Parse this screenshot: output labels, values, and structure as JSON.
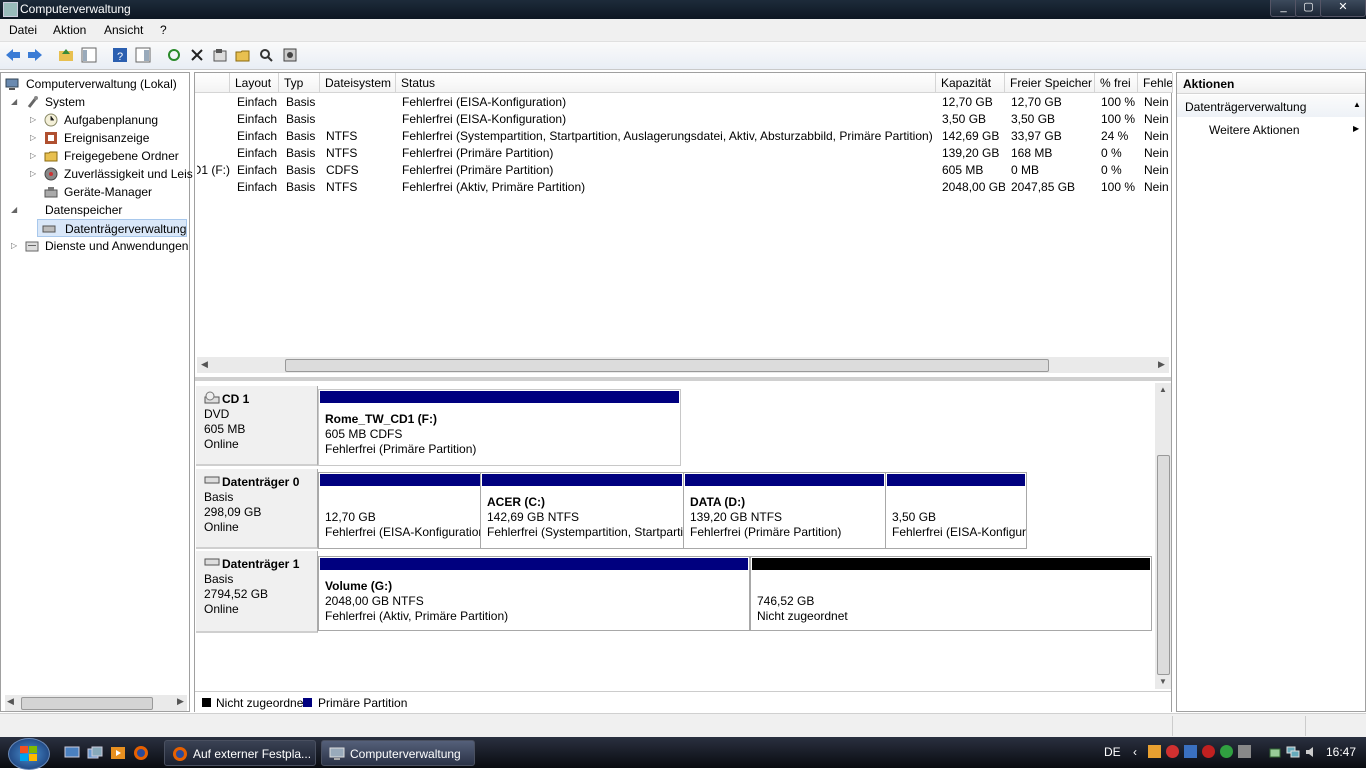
{
  "window": {
    "title": "Computerverwaltung"
  },
  "menu": [
    "Datei",
    "Aktion",
    "Ansicht",
    "?"
  ],
  "tree": {
    "root": "Computerverwaltung (Lokal)",
    "system": "System",
    "aufgaben": "Aufgabenplanung",
    "ereignis": "Ereignisanzeige",
    "ordner": "Freigegebene Ordner",
    "zuverl": "Zuverlässigkeit und Leis",
    "geraete": "Geräte-Manager",
    "datenspeicher": "Datenspeicher",
    "datentraeger": "Datenträgerverwaltung",
    "dienste": "Dienste und Anwendungen"
  },
  "list": {
    "headers": [
      "Layout",
      "Typ",
      "Dateisystem",
      "Status",
      "Kapazität",
      "Freier Speicher",
      "% frei",
      "Fehle"
    ],
    "rows": [
      {
        "volume": "",
        "layout": "Einfach",
        "typ": "Basis",
        "fs": "",
        "status": "Fehlerfrei (EISA-Konfiguration)",
        "kap": "12,70 GB",
        "frei": "12,70 GB",
        "pct": "100 %",
        "fehler": "Nein"
      },
      {
        "volume": "",
        "layout": "Einfach",
        "typ": "Basis",
        "fs": "",
        "status": "Fehlerfrei (EISA-Konfiguration)",
        "kap": "3,50 GB",
        "frei": "3,50 GB",
        "pct": "100 %",
        "fehler": "Nein"
      },
      {
        "volume": "",
        "layout": "Einfach",
        "typ": "Basis",
        "fs": "NTFS",
        "status": "Fehlerfrei (Systempartition, Startpartition, Auslagerungsdatei, Aktiv, Absturzabbild, Primäre Partition)",
        "kap": "142,69 GB",
        "frei": "33,97 GB",
        "pct": "24 %",
        "fehler": "Nein"
      },
      {
        "volume": "",
        "layout": "Einfach",
        "typ": "Basis",
        "fs": "NTFS",
        "status": "Fehlerfrei (Primäre Partition)",
        "kap": "139,20 GB",
        "frei": "168 MB",
        "pct": "0 %",
        "fehler": "Nein"
      },
      {
        "volume": "D1 (F:)",
        "layout": "Einfach",
        "typ": "Basis",
        "fs": "CDFS",
        "status": "Fehlerfrei (Primäre Partition)",
        "kap": "605 MB",
        "frei": "0 MB",
        "pct": "0 %",
        "fehler": "Nein"
      },
      {
        "volume": "",
        "layout": "Einfach",
        "typ": "Basis",
        "fs": "NTFS",
        "status": "Fehlerfrei (Aktiv, Primäre Partition)",
        "kap": "2048,00 GB",
        "frei": "2047,85 GB",
        "pct": "100 %",
        "fehler": "Nein"
      }
    ]
  },
  "disks": {
    "cd1": {
      "name": "CD 1",
      "type": "DVD",
      "size": "605 MB",
      "state": "Online",
      "p1": {
        "l1": "Rome_TW_CD1  (F:)",
        "l2": "605 MB CDFS",
        "l3": "Fehlerfrei (Primäre Partition)"
      }
    },
    "d0": {
      "name": "Datenträger 0",
      "type": "Basis",
      "size": "298,09 GB",
      "state": "Online",
      "p1": {
        "l1": "",
        "l2": "12,70 GB",
        "l3": "Fehlerfrei (EISA-Konfiguration)"
      },
      "p2": {
        "l1": "ACER  (C:)",
        "l2": "142,69 GB NTFS",
        "l3": "Fehlerfrei (Systempartition, Startpartition"
      },
      "p3": {
        "l1": "DATA  (D:)",
        "l2": "139,20 GB NTFS",
        "l3": "Fehlerfrei (Primäre Partition)"
      },
      "p4": {
        "l1": "",
        "l2": "3,50 GB",
        "l3": "Fehlerfrei (EISA-Konfiguration)"
      }
    },
    "d1": {
      "name": "Datenträger 1",
      "type": "Basis",
      "size": "2794,52 GB",
      "state": "Online",
      "p1": {
        "l1": "Volume  (G:)",
        "l2": "2048,00 GB NTFS",
        "l3": "Fehlerfrei (Aktiv, Primäre Partition)"
      },
      "p2": {
        "l1": "",
        "l2": "746,52 GB",
        "l3": "Nicht zugeordnet"
      }
    }
  },
  "legend": {
    "unalloc": "Nicht zugeordnet",
    "primary": "Primäre Partition"
  },
  "colors": {
    "primary": "#00007f",
    "unallocated": "#000000"
  },
  "actions": {
    "title": "Aktionen",
    "section": "Datenträgerverwaltung",
    "more": "Weitere Aktionen"
  },
  "taskbar": {
    "task1": "Auf externer Festpla...",
    "task2": "Computerverwaltung",
    "lang": "DE",
    "time": "16:47"
  }
}
